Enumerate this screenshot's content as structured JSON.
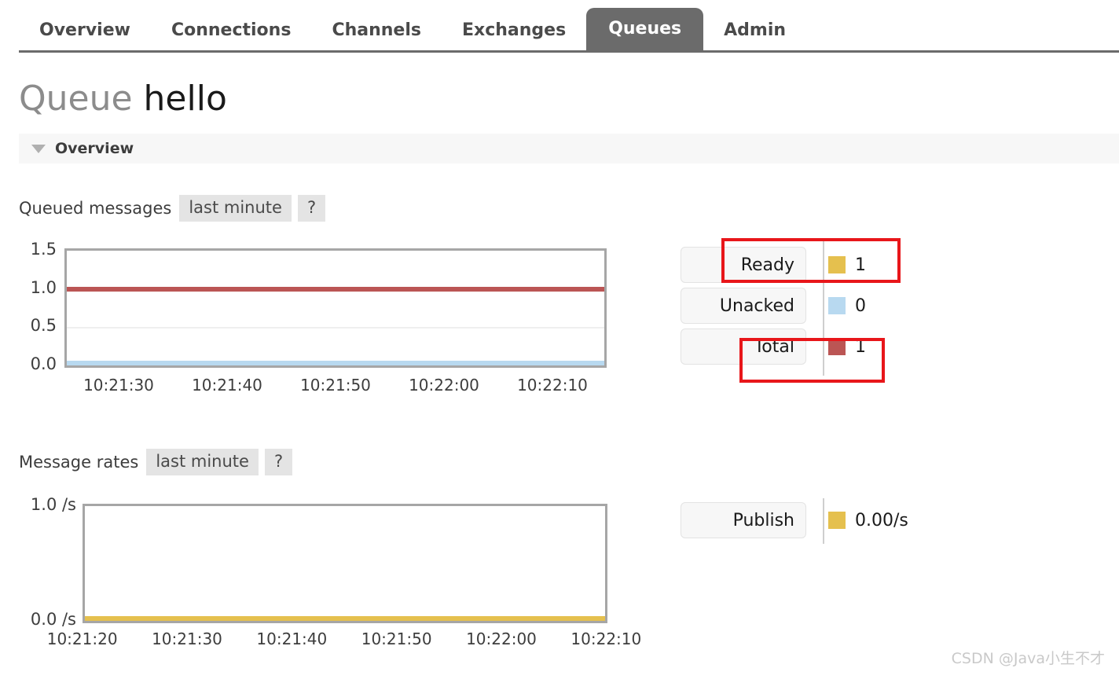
{
  "nav": {
    "tabs": [
      {
        "label": "Overview",
        "active": false
      },
      {
        "label": "Connections",
        "active": false
      },
      {
        "label": "Channels",
        "active": false
      },
      {
        "label": "Exchanges",
        "active": false
      },
      {
        "label": "Queues",
        "active": true
      },
      {
        "label": "Admin",
        "active": false
      }
    ]
  },
  "page": {
    "title_prefix": "Queue",
    "queue_name": "hello",
    "section_label": "Overview",
    "caret_icon": "triangle-down-icon"
  },
  "queued_messages": {
    "caption": "Queued messages",
    "period_label": "last minute",
    "help_label": "?",
    "legend": [
      {
        "label": "Ready",
        "value": "1",
        "color": "#e5c04e"
      },
      {
        "label": "Unacked",
        "value": "0",
        "color": "#b8d9f0"
      },
      {
        "label": "Total",
        "value": "1",
        "color": "#bb5554"
      }
    ],
    "highlighted_rows": [
      "Ready",
      "Total"
    ]
  },
  "message_rates": {
    "caption": "Message rates",
    "period_label": "last minute",
    "help_label": "?",
    "legend": [
      {
        "label": "Publish",
        "value": "0.00/s",
        "color": "#e5c04e"
      }
    ]
  },
  "chart_data": [
    {
      "type": "line",
      "title": "Queued messages",
      "subtitle": "last minute",
      "xlabel": "",
      "ylabel": "",
      "ylim": [
        0.0,
        1.5
      ],
      "yticks": [
        "0.0",
        "0.5",
        "1.0",
        "1.5"
      ],
      "ytick_values": [
        0.0,
        0.5,
        1.0,
        1.5
      ],
      "x": [
        "10:21:30",
        "10:21:40",
        "10:21:50",
        "10:22:00",
        "10:22:10"
      ],
      "grid": true,
      "legend_position": "right",
      "series": [
        {
          "name": "Ready",
          "color": "#e5c04e",
          "values": [
            1,
            1,
            1,
            1,
            1
          ]
        },
        {
          "name": "Unacked",
          "color": "#b8d9f0",
          "values": [
            0,
            0,
            0,
            0,
            0
          ]
        },
        {
          "name": "Total",
          "color": "#bb5554",
          "values": [
            1,
            1,
            1,
            1,
            1
          ]
        }
      ]
    },
    {
      "type": "line",
      "title": "Message rates",
      "subtitle": "last minute",
      "xlabel": "",
      "ylabel": "",
      "ylim": [
        0.0,
        1.0
      ],
      "yticks": [
        "0.0 /s",
        "1.0 /s"
      ],
      "ytick_values": [
        0.0,
        1.0
      ],
      "x": [
        "10:21:20",
        "10:21:30",
        "10:21:40",
        "10:21:50",
        "10:22:00",
        "10:22:10"
      ],
      "grid": false,
      "legend_position": "right",
      "series": [
        {
          "name": "Publish",
          "color": "#e5c04e",
          "values": [
            0,
            0,
            0,
            0,
            0,
            0
          ]
        }
      ]
    }
  ],
  "watermark": "CSDN @Java小生不才",
  "colors": {
    "accent_active_tab": "#6b6b6b",
    "annotation": "#e8161a",
    "ready": "#e5c04e",
    "unacked": "#b8d9f0",
    "total": "#bb5554"
  }
}
